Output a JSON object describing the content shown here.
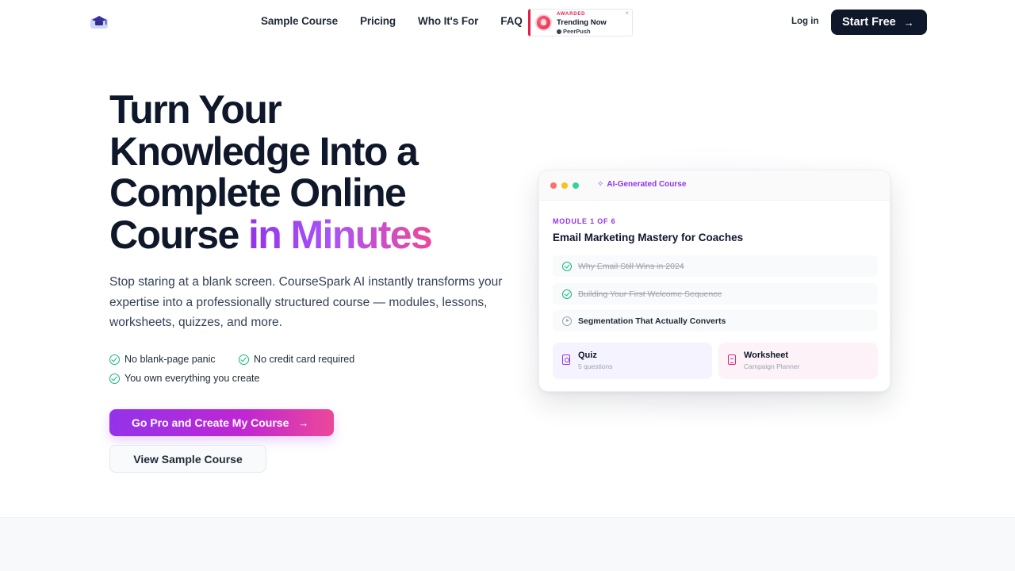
{
  "nav": {
    "links": [
      "Sample Course",
      "Pricing",
      "Who It's For",
      "FAQ"
    ],
    "badge": {
      "kicker": "AWARDED",
      "title": "Trending Now",
      "source": "PeerPush",
      "close": "×"
    },
    "login": "Log in",
    "start": "Start Free",
    "arrow": "→"
  },
  "hero": {
    "headline_lines": [
      "Turn Your",
      "Knowledge Into a",
      "Complete Online",
      "Course "
    ],
    "headline_accent": "in Minutes",
    "lead": "Stop staring at a blank screen. CourseSpark AI instantly transforms your expertise into a professionally structured course — modules, lessons, worksheets, quizzes, and more.",
    "checks": [
      "No blank-page panic",
      "No credit card required",
      "You own everything you create"
    ],
    "cta_primary": "Go Pro and Create My Course",
    "cta_secondary": "View Sample Course"
  },
  "card": {
    "bar_title": "AI-Generated Course",
    "spark": "✧",
    "module": "MODULE 1 OF 6",
    "title": "Email Marketing Mastery for Coaches",
    "lessons": [
      {
        "text": "Why Email Still Wins in 2024",
        "state": "done"
      },
      {
        "text": "Building Your First Welcome Sequence",
        "state": "done"
      },
      {
        "text": "Segmentation That Actually Converts",
        "state": "active"
      }
    ],
    "tiles": [
      {
        "title": "Quiz",
        "sub": "5 questions"
      },
      {
        "title": "Worksheet",
        "sub": "Campaign Planner"
      }
    ]
  },
  "colors": {
    "accent_purple": "#9333ea",
    "accent_pink": "#ec4899",
    "dark": "#0f172a",
    "success": "#10b981"
  }
}
